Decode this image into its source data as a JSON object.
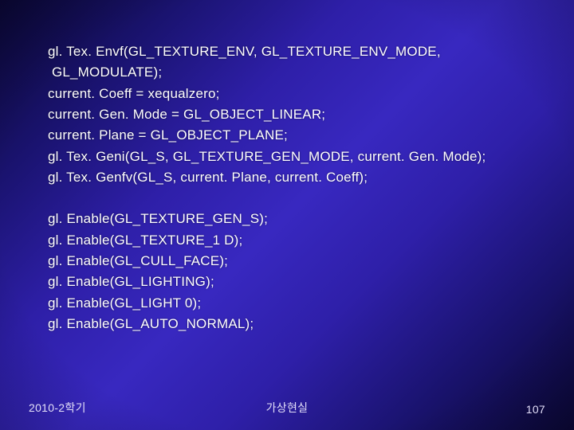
{
  "code": {
    "block1": [
      "gl. Tex. Envf(GL_TEXTURE_ENV, GL_TEXTURE_ENV_MODE,",
      " GL_MODULATE);",
      "current. Coeff = xequalzero;",
      "current. Gen. Mode = GL_OBJECT_LINEAR;",
      "current. Plane = GL_OBJECT_PLANE;",
      "gl. Tex. Geni(GL_S, GL_TEXTURE_GEN_MODE, current. Gen. Mode);",
      "gl. Tex. Genfv(GL_S, current. Plane, current. Coeff);"
    ],
    "block2": [
      "gl. Enable(GL_TEXTURE_GEN_S);",
      "gl. Enable(GL_TEXTURE_1 D);",
      "gl. Enable(GL_CULL_FACE);",
      "gl. Enable(GL_LIGHTING);",
      "gl. Enable(GL_LIGHT 0);",
      "gl. Enable(GL_AUTO_NORMAL);"
    ]
  },
  "footer": {
    "left": "2010-2학기",
    "center": "가상현실",
    "right": "107"
  }
}
